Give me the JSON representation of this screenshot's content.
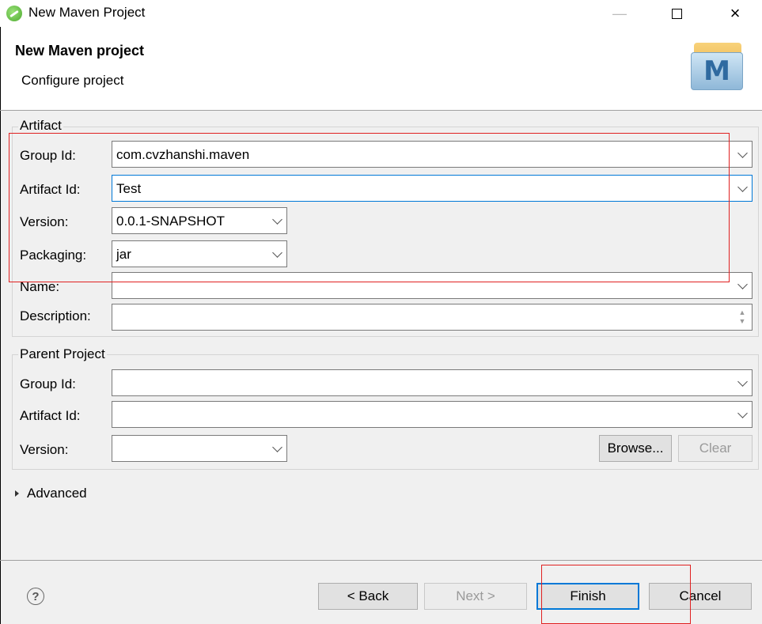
{
  "window": {
    "title": "New Maven Project"
  },
  "header": {
    "title": "New Maven project",
    "subtitle": "Configure project",
    "logo_letter": "M"
  },
  "artifact": {
    "legend": "Artifact",
    "group_id": {
      "label": "Group Id:",
      "value": "com.cvzhanshi.maven"
    },
    "artifact_id": {
      "label": "Artifact Id:",
      "value": "Test"
    },
    "version": {
      "label": "Version:",
      "value": "0.0.1-SNAPSHOT"
    },
    "packaging": {
      "label": "Packaging:",
      "value": "jar"
    },
    "name": {
      "label": "Name:",
      "value": ""
    },
    "description": {
      "label": "Description:",
      "value": ""
    }
  },
  "parent": {
    "legend": "Parent Project",
    "group_id": {
      "label": "Group Id:",
      "value": ""
    },
    "artifact_id": {
      "label": "Artifact Id:",
      "value": ""
    },
    "version": {
      "label": "Version:",
      "value": ""
    },
    "browse_label": "Browse...",
    "clear_label": "Clear"
  },
  "advanced": {
    "label": "Advanced"
  },
  "footer": {
    "help_glyph": "?",
    "back_label": "< Back",
    "next_label": "Next >",
    "finish_label": "Finish",
    "cancel_label": "Cancel"
  },
  "colors": {
    "focus_blue": "#0078d7",
    "annotation_red": "#e02020",
    "panel_bg": "#f0f0f0"
  }
}
